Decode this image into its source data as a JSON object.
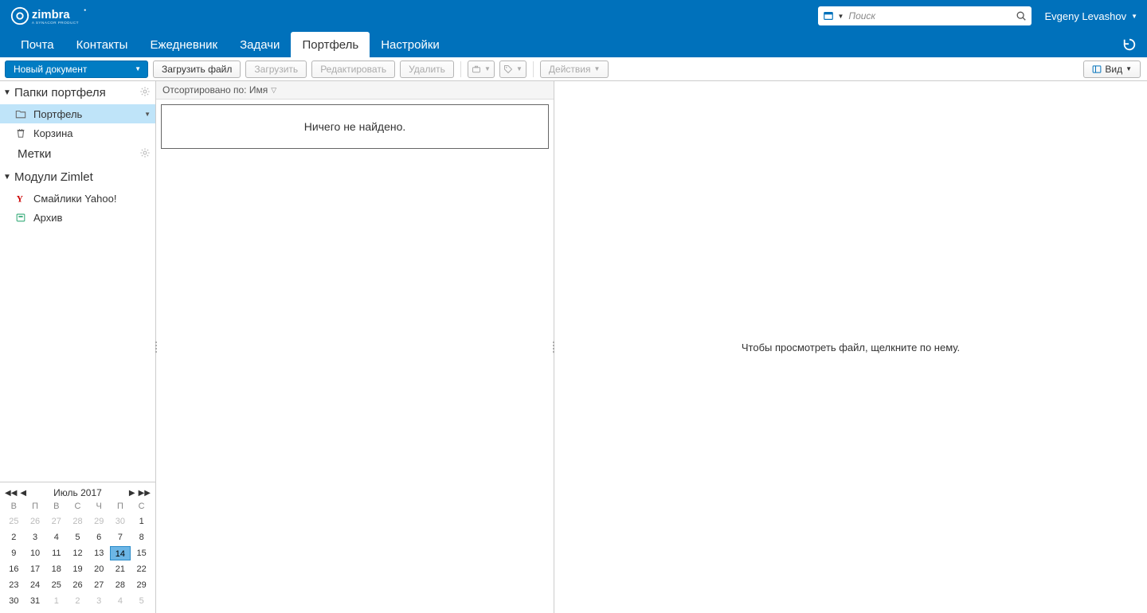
{
  "brand": {
    "name": "zimbra",
    "subtitle": "A SYNACOR PRODUCT"
  },
  "search": {
    "placeholder": "Поиск"
  },
  "user": {
    "name": "Evgeny Levashov"
  },
  "tabs": {
    "mail": "Почта",
    "contacts": "Контакты",
    "calendar": "Ежедневник",
    "tasks": "Задачи",
    "briefcase": "Портфель",
    "settings": "Настройки",
    "active": "briefcase"
  },
  "toolbar": {
    "new_doc": "Новый документ",
    "upload_file": "Загрузить файл",
    "download": "Загрузить",
    "edit": "Редактировать",
    "delete": "Удалить",
    "actions": "Действия",
    "view": "Вид"
  },
  "sidebar": {
    "folders_title": "Папки портфеля",
    "briefcase": "Портфель",
    "trash": "Корзина",
    "tags_title": "Метки",
    "zimlets_title": "Модули Zimlet",
    "zimlet_yahoo": "Смайлики Yahoo!",
    "zimlet_archive": "Архив"
  },
  "calendar": {
    "title": "Июль 2017",
    "dow": [
      "В",
      "П",
      "В",
      "С",
      "Ч",
      "П",
      "С"
    ],
    "weeks": [
      [
        {
          "n": 25,
          "g": 1
        },
        {
          "n": 26,
          "g": 1
        },
        {
          "n": 27,
          "g": 1
        },
        {
          "n": 28,
          "g": 1
        },
        {
          "n": 29,
          "g": 1
        },
        {
          "n": 30,
          "g": 1
        },
        {
          "n": 1
        }
      ],
      [
        {
          "n": 2
        },
        {
          "n": 3
        },
        {
          "n": 4
        },
        {
          "n": 5
        },
        {
          "n": 6
        },
        {
          "n": 7
        },
        {
          "n": 8
        }
      ],
      [
        {
          "n": 9
        },
        {
          "n": 10
        },
        {
          "n": 11
        },
        {
          "n": 12
        },
        {
          "n": 13
        },
        {
          "n": 14,
          "t": 1
        },
        {
          "n": 15
        }
      ],
      [
        {
          "n": 16
        },
        {
          "n": 17
        },
        {
          "n": 18
        },
        {
          "n": 19
        },
        {
          "n": 20
        },
        {
          "n": 21
        },
        {
          "n": 22
        }
      ],
      [
        {
          "n": 23
        },
        {
          "n": 24
        },
        {
          "n": 25
        },
        {
          "n": 26
        },
        {
          "n": 27
        },
        {
          "n": 28
        },
        {
          "n": 29
        }
      ],
      [
        {
          "n": 30
        },
        {
          "n": 31
        },
        {
          "n": 1,
          "g": 1
        },
        {
          "n": 2,
          "g": 1
        },
        {
          "n": 3,
          "g": 1
        },
        {
          "n": 4,
          "g": 1
        },
        {
          "n": 5,
          "g": 1
        }
      ]
    ]
  },
  "list": {
    "sort_label": "Отсортировано по: Имя",
    "empty": "Ничего не найдено."
  },
  "preview": {
    "prompt": "Чтобы просмотреть файл, щелкните по нему."
  }
}
